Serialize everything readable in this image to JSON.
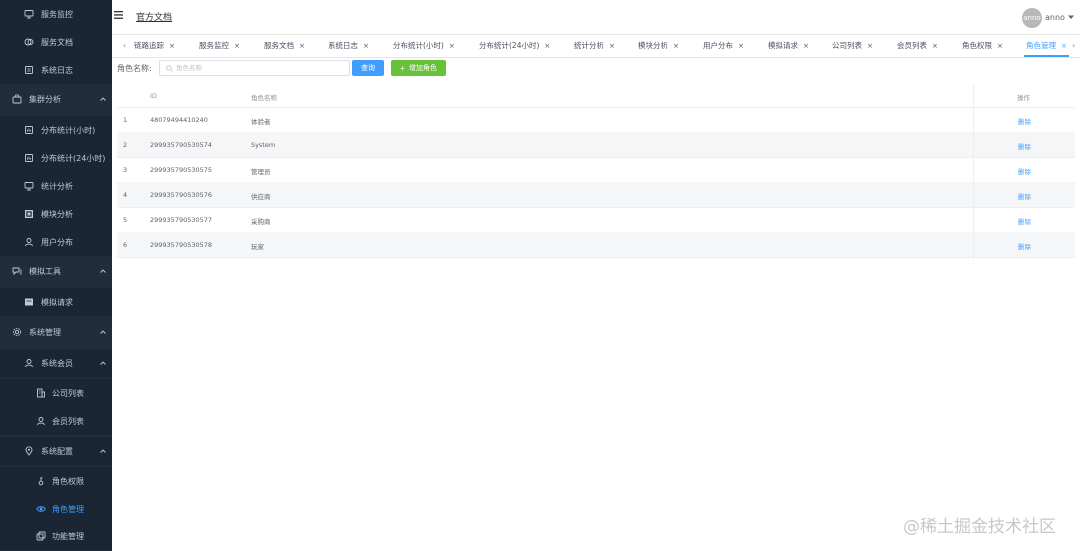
{
  "sidebar": {
    "items": [
      {
        "label": "服务监控",
        "icon": "monitor-icon"
      },
      {
        "label": "服务文档",
        "icon": "document-icon"
      },
      {
        "label": "系统日志",
        "icon": "log-icon"
      },
      {
        "label": "集群分析",
        "icon": "cluster-icon",
        "expandable": true
      },
      {
        "label": "分布统计(小时)",
        "icon": "chart-icon"
      },
      {
        "label": "分布统计(24小时)",
        "icon": "chart-icon"
      },
      {
        "label": "统计分析",
        "icon": "monitor-icon"
      },
      {
        "label": "模块分析",
        "icon": "module-icon"
      },
      {
        "label": "用户分布",
        "icon": "user-icon"
      },
      {
        "label": "模拟工具",
        "icon": "tools-icon",
        "expandable": true
      },
      {
        "label": "模拟请求",
        "icon": "request-icon"
      },
      {
        "label": "系统管理",
        "icon": "gear-icon",
        "expandable": true
      },
      {
        "label": "系统会员",
        "icon": "user-icon",
        "expandable": true
      },
      {
        "label": "公司列表",
        "icon": "building-icon"
      },
      {
        "label": "会员列表",
        "icon": "user-icon"
      },
      {
        "label": "系统配置",
        "icon": "location-icon",
        "expandable": true
      },
      {
        "label": "角色权限",
        "icon": "key-icon"
      },
      {
        "label": "角色管理",
        "icon": "eye-icon",
        "active": true
      },
      {
        "label": "功能管理",
        "icon": "copy-icon"
      }
    ]
  },
  "topbar": {
    "doc_link": "官方文档",
    "avatar_text": "anno",
    "username": "anno"
  },
  "tabs": [
    {
      "label": "链路追踪"
    },
    {
      "label": "服务监控"
    },
    {
      "label": "服务文档"
    },
    {
      "label": "系统日志"
    },
    {
      "label": "分布统计(小时)"
    },
    {
      "label": "分布统计(24小时)"
    },
    {
      "label": "统计分析"
    },
    {
      "label": "模块分析"
    },
    {
      "label": "用户分布"
    },
    {
      "label": "模拟请求"
    },
    {
      "label": "公司列表"
    },
    {
      "label": "会员列表"
    },
    {
      "label": "角色权限"
    },
    {
      "label": "角色管理",
      "active": true
    }
  ],
  "filter": {
    "label": "角色名称:",
    "placeholder": "角色名称",
    "query_button": "查询",
    "add_button": "增加角色"
  },
  "table": {
    "headers": {
      "id": "ID",
      "name": "角色名称",
      "action": "操作"
    },
    "rows": [
      {
        "index": "1",
        "id": "48079494410240",
        "name": "体验者",
        "action": "删除"
      },
      {
        "index": "2",
        "id": "299935790530574",
        "name": "System",
        "action": "删除"
      },
      {
        "index": "3",
        "id": "299935790530575",
        "name": "管理员",
        "action": "删除"
      },
      {
        "index": "4",
        "id": "299935790530576",
        "name": "供应商",
        "action": "删除"
      },
      {
        "index": "5",
        "id": "299935790530577",
        "name": "采购商",
        "action": "删除"
      },
      {
        "index": "6",
        "id": "299935790530578",
        "name": "玩家",
        "action": "删除"
      }
    ]
  },
  "watermark": "@稀土掘金技术社区",
  "colors": {
    "sidebar_bg": "#1f2d3d",
    "sidebar_text": "#bfcbd9",
    "accent": "#409eff",
    "success": "#67c23a"
  }
}
